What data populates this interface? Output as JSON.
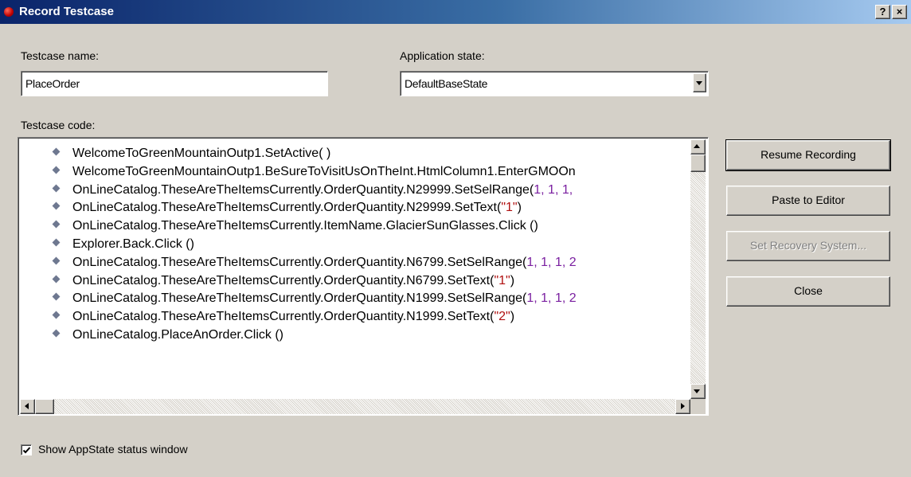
{
  "window": {
    "title": "Record Testcase",
    "help_label": "?",
    "close_label": "×"
  },
  "form": {
    "testcase_name_label": "Testcase name:",
    "testcase_name_value": "PlaceOrder",
    "app_state_label": "Application state:",
    "app_state_value": "DefaultBaseState",
    "code_label": "Testcase code:"
  },
  "code_lines": [
    [
      {
        "t": "WelcomeToGreenMountainOutp1.SetActive( )"
      }
    ],
    [
      {
        "t": "WelcomeToGreenMountainOutp1.BeSureToVisitUsOnTheInt.HtmlColumn1.EnterGMOOn"
      }
    ],
    [
      {
        "t": "OnLineCatalog.TheseAreTheItemsCurrently.OrderQuantity.N29999.SetSelRange("
      },
      {
        "t": "1, 1, 1,",
        "c": "num"
      }
    ],
    [
      {
        "t": "OnLineCatalog.TheseAreTheItemsCurrently.OrderQuantity.N29999.SetText("
      },
      {
        "t": "\"1\"",
        "c": "str"
      },
      {
        "t": ")"
      }
    ],
    [
      {
        "t": "OnLineCatalog.TheseAreTheItemsCurrently.ItemName.GlacierSunGlasses.Click ()"
      }
    ],
    [
      {
        "t": "Explorer.Back.Click ()"
      }
    ],
    [
      {
        "t": "OnLineCatalog.TheseAreTheItemsCurrently.OrderQuantity.N6799.SetSelRange("
      },
      {
        "t": "1, 1, 1, 2",
        "c": "num"
      }
    ],
    [
      {
        "t": "OnLineCatalog.TheseAreTheItemsCurrently.OrderQuantity.N6799.SetText("
      },
      {
        "t": "\"1\"",
        "c": "str"
      },
      {
        "t": ")"
      }
    ],
    [
      {
        "t": "OnLineCatalog.TheseAreTheItemsCurrently.OrderQuantity.N1999.SetSelRange("
      },
      {
        "t": "1, 1, 1, 2",
        "c": "num"
      }
    ],
    [
      {
        "t": "OnLineCatalog.TheseAreTheItemsCurrently.OrderQuantity.N1999.SetText("
      },
      {
        "t": "\"2\"",
        "c": "str"
      },
      {
        "t": ")"
      }
    ],
    [
      {
        "t": "OnLineCatalog.PlaceAnOrder.Click ()"
      }
    ]
  ],
  "buttons": {
    "resume": "Resume Recording",
    "paste": "Paste to Editor",
    "recovery": "Set Recovery System...",
    "close": "Close"
  },
  "footer": {
    "show_status_label": "Show AppState status window",
    "show_status_checked": true
  },
  "colors": {
    "number": "#7a1fa0",
    "string": "#b01010"
  }
}
